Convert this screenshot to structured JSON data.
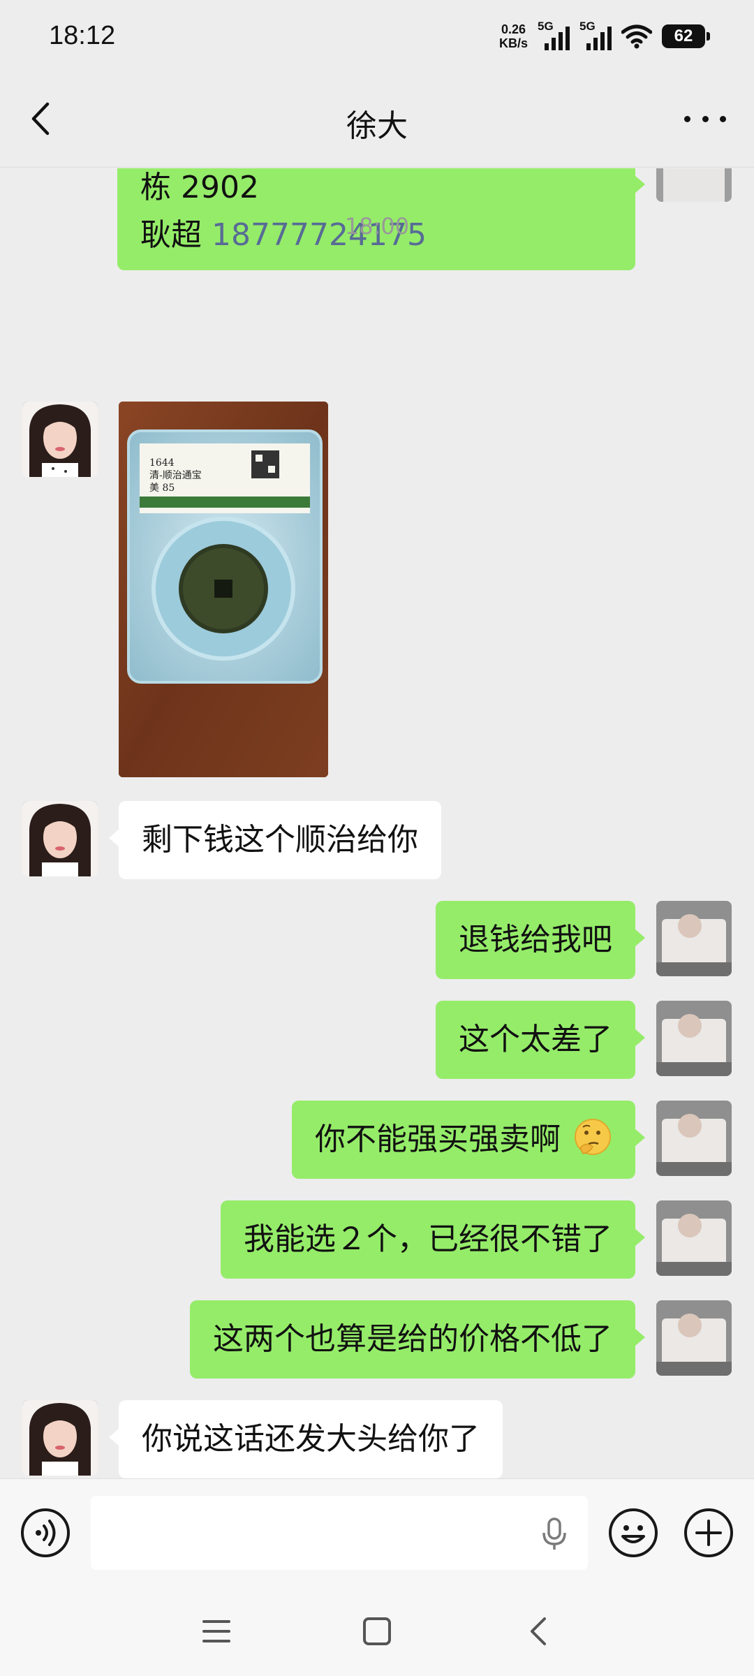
{
  "status_bar": {
    "time": "18:12",
    "net_speed_value": "0.26",
    "net_speed_unit": "KB/s",
    "sim1_label": "5G",
    "sim2_label": "5G",
    "battery": "62"
  },
  "header": {
    "title": "徐大"
  },
  "messages": {
    "m0_line1": "栋 2902",
    "m0_line2_name": "耿超 ",
    "m0_line2_phone": "18777724175",
    "timestamp": "18:00",
    "m2": "剩下钱这个顺治给你",
    "m3": "退钱给我吧",
    "m4": "这个太差了",
    "m5": "你不能强买强卖啊",
    "m6": "我能选２个，已经很不错了",
    "m7": "这两个也算是给的价格不低了",
    "m8": "你说这话还发大头给你了"
  },
  "coin_label": {
    "line1": "1644",
    "line2": "清-顺治通宝",
    "line3": "美 85"
  },
  "colors": {
    "sent_bubble": "#95ec69",
    "received_bubble": "#ffffff",
    "chat_background": "#ededed",
    "link": "#576b95"
  }
}
